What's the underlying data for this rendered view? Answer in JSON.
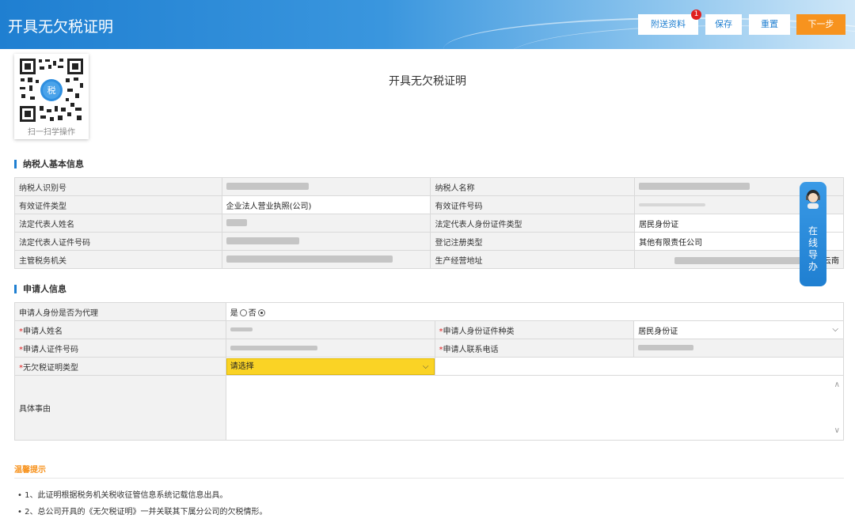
{
  "header": {
    "title": "开具无欠税证明",
    "attach_label": "附送资料",
    "attach_badge": "1",
    "save_label": "保存",
    "reset_label": "重置",
    "next_label": "下一步",
    "accent": "#1f7fd1",
    "next_color": "#f7931e"
  },
  "qr": {
    "caption": "扫一扫学操作",
    "logo_text": "税"
  },
  "page_title": "开具无欠税证明",
  "taxpayer": {
    "section_title": "纳税人基本信息",
    "rows": [
      {
        "l1": "纳税人识别号",
        "v1": "",
        "l2": "纳税人名称",
        "v2": ""
      },
      {
        "l1": "有效证件类型",
        "v1": "企业法人营业执照(公司)",
        "l2": "有效证件号码",
        "v2": ""
      },
      {
        "l1": "法定代表人姓名",
        "v1": "",
        "l2": "法定代表人身份证件类型",
        "v2": "居民身份证"
      },
      {
        "l1": "法定代表人证件号码",
        "v1": "",
        "l2": "登记注册类型",
        "v2": "其他有限责任公司"
      },
      {
        "l1": "主管税务机关",
        "v1": "",
        "l2": "生产经营地址",
        "v2": "(云南"
      }
    ]
  },
  "applicant": {
    "section_title": "申请人信息",
    "proxy_label": "申请人身份是否为代理",
    "yes_label": "是",
    "no_label": "否",
    "proxy_selected": "否",
    "required_mark": "*",
    "name_label": "申请人姓名",
    "id_type_label": "申请人身份证件种类",
    "id_type_value": "居民身份证",
    "id_no_label": "申请人证件号码",
    "phone_label": "申请人联系电话",
    "cert_type_label": "无欠税证明类型",
    "cert_type_value": "请选择",
    "reason_label": "具体事由"
  },
  "online": {
    "text": "在线导办"
  },
  "tips": {
    "title": "温馨提示",
    "items": [
      "1、此证明根据税务机关税收征管信息系统记载信息出具。",
      "2、总公司开具的《无欠税证明》一并关联其下属分公司的欠税情形。"
    ]
  }
}
